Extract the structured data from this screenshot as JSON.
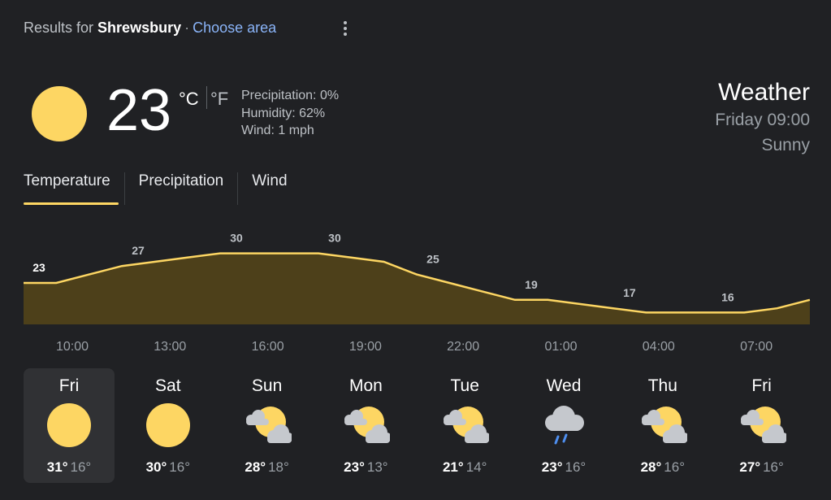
{
  "header": {
    "results_prefix": "Results for",
    "location": "Shrewsbury",
    "separator": "·",
    "choose_area": "Choose area"
  },
  "current": {
    "temperature": "23",
    "unit_c": "°C",
    "unit_f": "°F",
    "precipitation": "Precipitation: 0%",
    "humidity": "Humidity: 62%",
    "wind": "Wind: 1 mph",
    "icon": "sun-icon"
  },
  "summary": {
    "title": "Weather",
    "datetime": "Friday 09:00",
    "condition": "Sunny"
  },
  "tabs": [
    {
      "label": "Temperature",
      "active": true
    },
    {
      "label": "Precipitation",
      "active": false
    },
    {
      "label": "Wind",
      "active": false
    }
  ],
  "chart_data": {
    "type": "area",
    "temps": [
      23,
      23,
      25,
      27,
      28,
      29,
      30,
      30,
      30,
      30,
      29,
      28,
      25,
      23,
      21,
      19,
      19,
      18,
      17,
      16,
      16,
      16,
      16,
      17,
      19
    ],
    "point_labels": [
      "23",
      "27",
      "30",
      "30",
      "25",
      "19",
      "17",
      "16"
    ],
    "label_indices": [
      0,
      3,
      6,
      9,
      12,
      15,
      18,
      21
    ],
    "tick_labels": [
      "10:00",
      "13:00",
      "16:00",
      "19:00",
      "22:00",
      "01:00",
      "04:00",
      "07:00"
    ],
    "line_color": "#fdd663",
    "fill_color": "#4d401a"
  },
  "forecast": [
    {
      "day": "Fri",
      "high": "31°",
      "low": "16°",
      "icon": "sun-icon",
      "selected": true
    },
    {
      "day": "Sat",
      "high": "30°",
      "low": "16°",
      "icon": "sun-icon",
      "selected": false
    },
    {
      "day": "Sun",
      "high": "28°",
      "low": "18°",
      "icon": "partly-cloudy-icon",
      "selected": false
    },
    {
      "day": "Mon",
      "high": "23°",
      "low": "13°",
      "icon": "partly-cloudy-icon",
      "selected": false
    },
    {
      "day": "Tue",
      "high": "21°",
      "low": "14°",
      "icon": "partly-cloudy-icon",
      "selected": false
    },
    {
      "day": "Wed",
      "high": "23°",
      "low": "16°",
      "icon": "rain-icon",
      "selected": false
    },
    {
      "day": "Thu",
      "high": "28°",
      "low": "16°",
      "icon": "partly-cloudy-icon",
      "selected": false
    },
    {
      "day": "Fri",
      "high": "27°",
      "low": "16°",
      "icon": "partly-cloudy-icon",
      "selected": false
    }
  ]
}
